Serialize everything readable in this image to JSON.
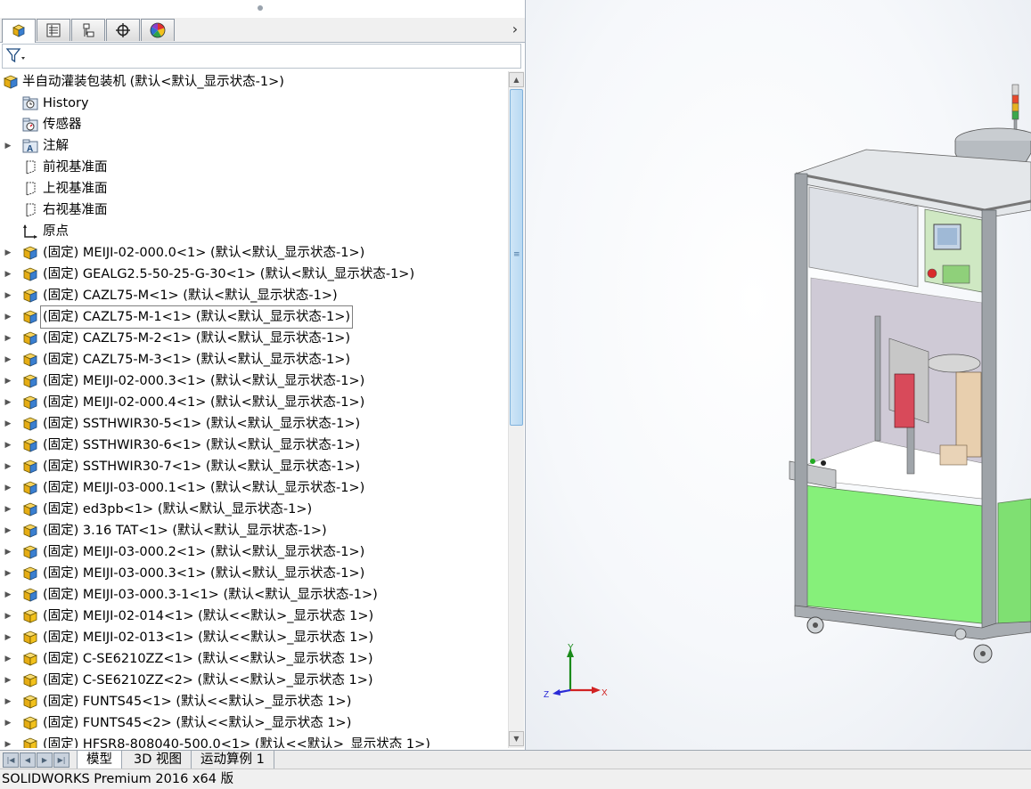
{
  "manager_tabs": [
    {
      "name": "feature-manager-tab",
      "icon": "assembly-icon",
      "active": true
    },
    {
      "name": "property-manager-tab",
      "icon": "property-list-icon",
      "active": false
    },
    {
      "name": "configuration-manager-tab",
      "icon": "configuration-icon",
      "active": false
    },
    {
      "name": "dimxpert-manager-tab",
      "icon": "crosshair-icon",
      "active": false
    },
    {
      "name": "display-manager-tab",
      "icon": "color-wheel-icon",
      "active": false
    }
  ],
  "more_tabs_glyph": "›",
  "tree": {
    "root": {
      "label": "半自动灌装包装机  (默认<默认_显示状态-1>)"
    },
    "items": [
      {
        "label": "History",
        "icon": "history-folder-icon",
        "expandable": false
      },
      {
        "label": "传感器",
        "icon": "sensor-icon",
        "expandable": false
      },
      {
        "label": "注解",
        "icon": "annotation-icon",
        "expandable": true
      },
      {
        "label": "前视基准面",
        "icon": "plane-icon",
        "expandable": false
      },
      {
        "label": "上视基准面",
        "icon": "plane-icon",
        "expandable": false
      },
      {
        "label": "右视基准面",
        "icon": "plane-icon",
        "expandable": false
      },
      {
        "label": "原点",
        "icon": "origin-icon",
        "expandable": false
      },
      {
        "label": "(固定) MEIJI-02-000.0<1> (默认<默认_显示状态-1>)",
        "icon": "subassembly-icon",
        "expandable": true
      },
      {
        "label": "(固定) GEALG2.5-50-25-G-30<1> (默认<默认_显示状态-1>)",
        "icon": "subassembly-icon",
        "expandable": true
      },
      {
        "label": "(固定) CAZL75-M<1> (默认<默认_显示状态-1>)",
        "icon": "subassembly-icon",
        "expandable": true
      },
      {
        "label": "(固定) CAZL75-M-1<1> (默认<默认_显示状态-1>)",
        "icon": "subassembly-icon",
        "expandable": true,
        "selected": true
      },
      {
        "label": "(固定) CAZL75-M-2<1> (默认<默认_显示状态-1>)",
        "icon": "subassembly-icon",
        "expandable": true
      },
      {
        "label": "(固定) CAZL75-M-3<1> (默认<默认_显示状态-1>)",
        "icon": "subassembly-icon",
        "expandable": true
      },
      {
        "label": "(固定) MEIJI-02-000.3<1> (默认<默认_显示状态-1>)",
        "icon": "subassembly-icon",
        "expandable": true
      },
      {
        "label": "(固定) MEIJI-02-000.4<1> (默认<默认_显示状态-1>)",
        "icon": "subassembly-icon",
        "expandable": true
      },
      {
        "label": "(固定) SSTHWIR30-5<1> (默认<默认_显示状态-1>)",
        "icon": "subassembly-icon",
        "expandable": true
      },
      {
        "label": "(固定) SSTHWIR30-6<1> (默认<默认_显示状态-1>)",
        "icon": "subassembly-icon",
        "expandable": true
      },
      {
        "label": "(固定) SSTHWIR30-7<1> (默认<默认_显示状态-1>)",
        "icon": "subassembly-icon",
        "expandable": true
      },
      {
        "label": "(固定) MEIJI-03-000.1<1> (默认<默认_显示状态-1>)",
        "icon": "subassembly-icon",
        "expandable": true
      },
      {
        "label": "(固定) ed3pb<1> (默认<默认_显示状态-1>)",
        "icon": "subassembly-icon",
        "expandable": true
      },
      {
        "label": "(固定) 3.16 TAT<1> (默认<默认_显示状态-1>)",
        "icon": "subassembly-icon",
        "expandable": true
      },
      {
        "label": "(固定) MEIJI-03-000.2<1> (默认<默认_显示状态-1>)",
        "icon": "subassembly-icon",
        "expandable": true
      },
      {
        "label": "(固定) MEIJI-03-000.3<1> (默认<默认_显示状态-1>)",
        "icon": "subassembly-icon",
        "expandable": true
      },
      {
        "label": "(固定) MEIJI-03-000.3-1<1> (默认<默认_显示状态-1>)",
        "icon": "subassembly-icon",
        "expandable": true
      },
      {
        "label": "(固定) MEIJI-02-014<1> (默认<<默认>_显示状态 1>)",
        "icon": "part-icon",
        "expandable": true
      },
      {
        "label": "(固定) MEIJI-02-013<1> (默认<<默认>_显示状态 1>)",
        "icon": "part-icon",
        "expandable": true
      },
      {
        "label": "(固定) C-SE6210ZZ<1> (默认<<默认>_显示状态 1>)",
        "icon": "part-icon",
        "expandable": true
      },
      {
        "label": "(固定) C-SE6210ZZ<2> (默认<<默认>_显示状态 1>)",
        "icon": "part-icon",
        "expandable": true
      },
      {
        "label": "(固定) FUNTS45<1> (默认<<默认>_显示状态 1>)",
        "icon": "part-icon",
        "expandable": true
      },
      {
        "label": "(固定) FUNTS45<2> (默认<<默认>_显示状态 1>)",
        "icon": "part-icon",
        "expandable": true
      },
      {
        "label": "(固定) HFSR8-808040-500.0<1> (默认<<默认>_显示状态 1>)",
        "icon": "part-icon",
        "expandable": true
      }
    ]
  },
  "bottom_tabs": [
    {
      "label": "模型",
      "active": true
    },
    {
      "label": "3D 视图",
      "active": false
    },
    {
      "label": "运动算例 1",
      "active": false
    }
  ],
  "status": {
    "text": "SOLIDWORKS Premium 2016 x64 版"
  },
  "triad": {
    "x_label": "X",
    "y_label": "Y",
    "z_label": "Z"
  },
  "colors": {
    "panel_green": "#86f07a",
    "frame_gray": "#9ea3a8",
    "assembly_yellow": "#f2c11c",
    "assembly_blue": "#3a7fd0",
    "selection_outline": "#7f7f7f"
  }
}
